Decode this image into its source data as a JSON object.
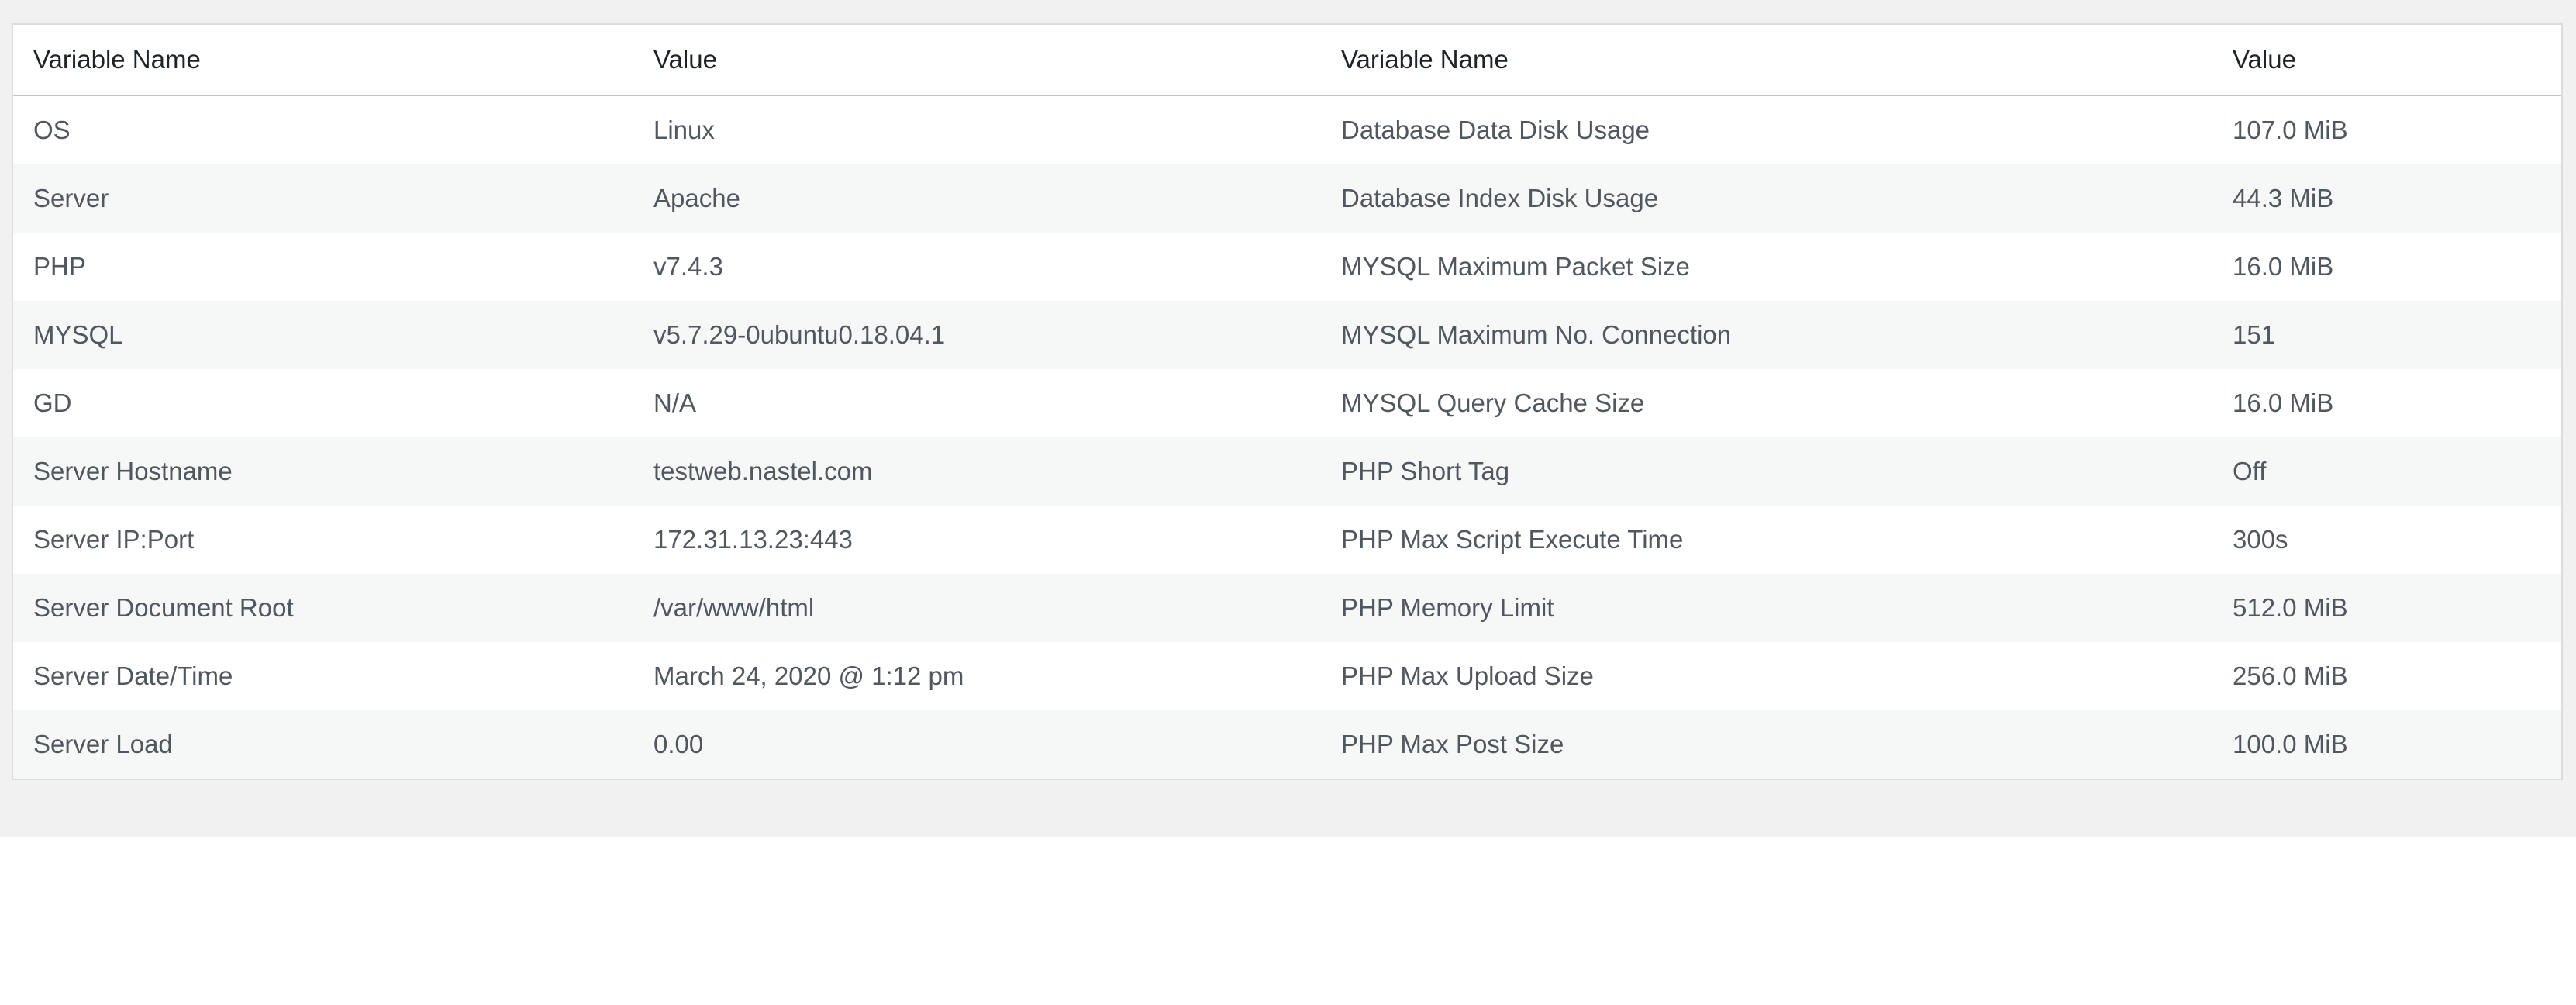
{
  "table": {
    "headers": [
      "Variable Name",
      "Value",
      "Variable Name",
      "Value"
    ],
    "rows": [
      [
        "OS",
        "Linux",
        "Database Data Disk Usage",
        "107.0 MiB"
      ],
      [
        "Server",
        "Apache",
        "Database Index Disk Usage",
        "44.3 MiB"
      ],
      [
        "PHP",
        "v7.4.3",
        "MYSQL Maximum Packet Size",
        "16.0 MiB"
      ],
      [
        "MYSQL",
        "v5.7.29-0ubuntu0.18.04.1",
        "MYSQL Maximum No. Connection",
        "151"
      ],
      [
        "GD",
        "N/A",
        "MYSQL Query Cache Size",
        "16.0 MiB"
      ],
      [
        "Server Hostname",
        "testweb.nastel.com",
        "PHP Short Tag",
        "Off"
      ],
      [
        "Server IP:Port",
        "172.31.13.23:443",
        "PHP Max Script Execute Time",
        "300s"
      ],
      [
        "Server Document Root",
        "/var/www/html",
        "PHP Memory Limit",
        "512.0 MiB"
      ],
      [
        "Server Date/Time",
        "March 24, 2020 @ 1:12 pm",
        "PHP Max Upload Size",
        "256.0 MiB"
      ],
      [
        "Server Load",
        "0.00",
        "PHP Max Post Size",
        "100.0 MiB"
      ]
    ]
  },
  "colors": {
    "page_background": "#f1f1f1",
    "table_border": "#dcdcde",
    "row_alt_background": "#f6f7f7",
    "header_text": "#1d2327",
    "body_text": "#50575e"
  }
}
